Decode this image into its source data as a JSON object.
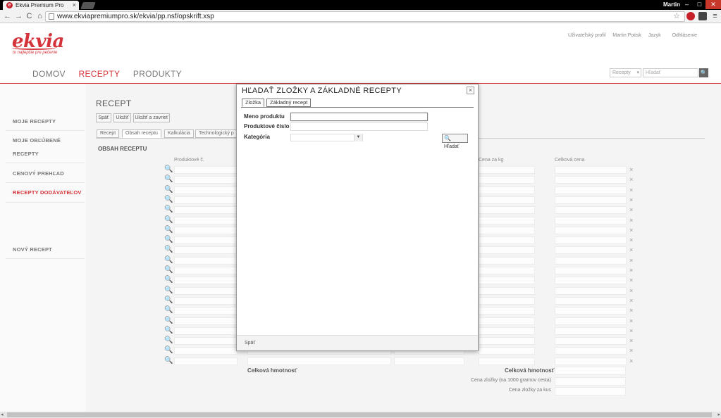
{
  "browser": {
    "tab_title": "Ekvia Premium Pro",
    "tab_close": "×",
    "favicon": "e",
    "url": "www.ekviapremiumpro.sk/ekvia/pp.nsf/opskrift.xsp",
    "user": "Martin",
    "icons": [
      "back-icon",
      "forward-icon",
      "reload-icon",
      "home-icon",
      "star-icon",
      "menu-icon"
    ],
    "nav": {
      "back": "←",
      "forward": "→",
      "reload": "C",
      "home": "⌂",
      "star": "☆",
      "menu": "≡"
    },
    "window": {
      "minimize": "–",
      "maximize": "□",
      "close": "✕"
    }
  },
  "header": {
    "logo": "ekvia",
    "tagline": "to najlepšie pre pečenie",
    "links": [
      "Užívateľský profil",
      "Martin Potisk",
      "Jazyk",
      "Odhlásenie"
    ],
    "nav": [
      "DOMOV",
      "RECEPTY",
      "PRODUKTY"
    ],
    "active_nav": "RECEPTY",
    "search_select": "Recepty",
    "search_placeholder": "Hľadať",
    "search_icon": "🔍",
    "accent_color": "#d5333a"
  },
  "sidebar": {
    "items": [
      "MOJE RECEPTY",
      "MOJE OBĽÚBENÉ",
      "RECEPTY",
      "CENOVÝ PREHĽAD",
      "RECEPTY DODÁVATEĽOV",
      "NOVÝ RECEPT"
    ]
  },
  "page": {
    "title": "RECEPT",
    "buttons": [
      "Späť",
      "Uložiť",
      "Uložiť a zavrieť"
    ],
    "tabs": [
      "Recept",
      "Obsah receptu",
      "Kalkulácia",
      "Technologický p"
    ],
    "section_title": "OBSAH RECEPTU",
    "columns": [
      "Produktové č.",
      "Cena za kg",
      "Celková cena"
    ],
    "row_count": 20,
    "search_icon": "🔍",
    "remove_icon": "×",
    "total_weight_label": "Celková hmotnosť",
    "total_weight_label2": "Celková hmotnosť",
    "price_per_1000": "Cena zložky (na 1000 gramov cesta)",
    "price_per_piece": "Cena zložky za kus"
  },
  "modal": {
    "title": "HĽADAŤ ZLOŽKY A ZÁKLADNÉ RECEPTY",
    "close": "×",
    "tabs": [
      "Zložka",
      "Základný recept"
    ],
    "fields": {
      "name_label": "Meno produktu",
      "number_label": "Produktové číslo",
      "category_label": "Kategória"
    },
    "dropdown_arrow": "▼",
    "search_button": "Hľadať",
    "search_icon": "🔍",
    "footer_back": "Späť"
  },
  "scrollbar": {
    "left": "◂",
    "right": "▸"
  }
}
